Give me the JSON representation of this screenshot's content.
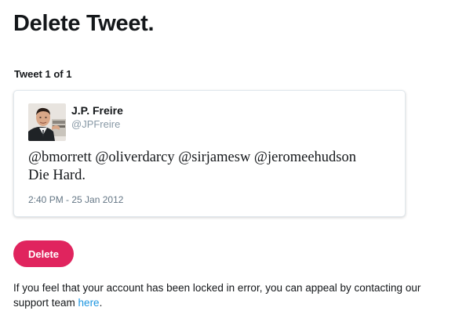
{
  "page": {
    "title": "Delete Tweet."
  },
  "tweet_count": "Tweet 1 of 1",
  "tweet": {
    "author_name": "J.P. Freire",
    "author_handle": "@JPFreire",
    "text_line1": "@bmorrett @oliverdarcy @sirjamesw @jeromeehudson",
    "text_line2": "Die Hard.",
    "timestamp": "2:40 PM - 25 Jan 2012",
    "avatar_icon": "user-avatar-photo"
  },
  "actions": {
    "delete_label": "Delete"
  },
  "appeal": {
    "text_before": "If you feel that your account has been locked in error, you can appeal by contacting our support team ",
    "link_label": "here",
    "text_after": "."
  },
  "colors": {
    "delete_button": "#e0245e",
    "link": "#1b95e0",
    "handle": "#8899a6"
  }
}
